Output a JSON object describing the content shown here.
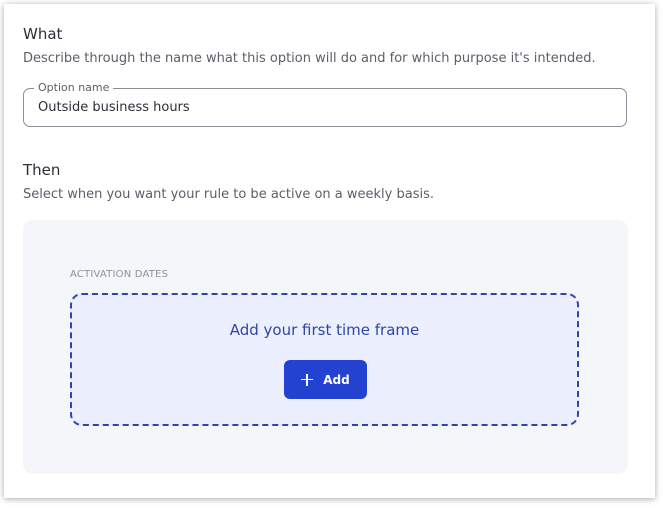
{
  "what": {
    "title": "What",
    "description": "Describe through the name what this option will do and for which purpose it's intended.",
    "field": {
      "label": "Option name",
      "value": "Outside business hours"
    }
  },
  "then": {
    "title": "Then",
    "description": "Select when you want your rule to be active on a weekly basis."
  },
  "activation": {
    "label": "ACTIVATION DATES",
    "empty_title": "Add your first time frame",
    "add_label": "Add"
  },
  "colors": {
    "accent": "#2442d0",
    "dropzone_border": "#2f45a8",
    "dropzone_bg": "#eceffd",
    "panel_bg": "#f5f6fa"
  },
  "icons": {
    "add": "plus-icon"
  }
}
